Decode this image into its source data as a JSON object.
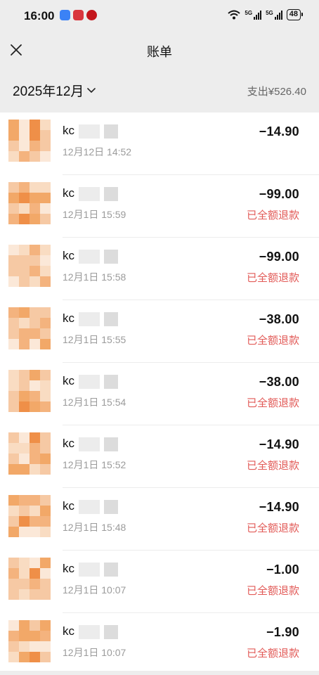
{
  "status_bar": {
    "time": "16:00",
    "battery": "48",
    "signal_1": "5G",
    "signal_2": "5G"
  },
  "nav": {
    "title": "账单",
    "close_icon": "close-icon"
  },
  "filter": {
    "month": "2025年12月",
    "expense_summary": "支出¥526.40"
  },
  "transactions": [
    {
      "name": "kc",
      "time": "12月12日 14:52",
      "amount": "−14.90",
      "status": ""
    },
    {
      "name": "kc",
      "time": "12月1日 15:59",
      "amount": "−99.00",
      "status": "已全额退款"
    },
    {
      "name": "kc",
      "time": "12月1日 15:58",
      "amount": "−99.00",
      "status": "已全额退款"
    },
    {
      "name": "kc",
      "time": "12月1日 15:55",
      "amount": "−38.00",
      "status": "已全额退款"
    },
    {
      "name": "kc",
      "time": "12月1日 15:54",
      "amount": "−38.00",
      "status": "已全额退款"
    },
    {
      "name": "kc",
      "time": "12月1日 15:52",
      "amount": "−14.90",
      "status": "已全额退款"
    },
    {
      "name": "kc",
      "time": "12月1日 15:48",
      "amount": "−14.90",
      "status": "已全额退款"
    },
    {
      "name": "kc",
      "time": "12月1日 10:07",
      "amount": "−1.00",
      "status": "已全额退款"
    },
    {
      "name": "kc",
      "time": "12月1日 10:07",
      "amount": "−1.90",
      "status": "已全额退款"
    }
  ],
  "colors": {
    "background": "#ededed",
    "refund_text": "#e25a57",
    "avatar_palette": [
      "#f6c9a4",
      "#f2a868",
      "#ef8f48",
      "#f9dcc2",
      "#f4b37e",
      "#fbe8d8"
    ]
  }
}
